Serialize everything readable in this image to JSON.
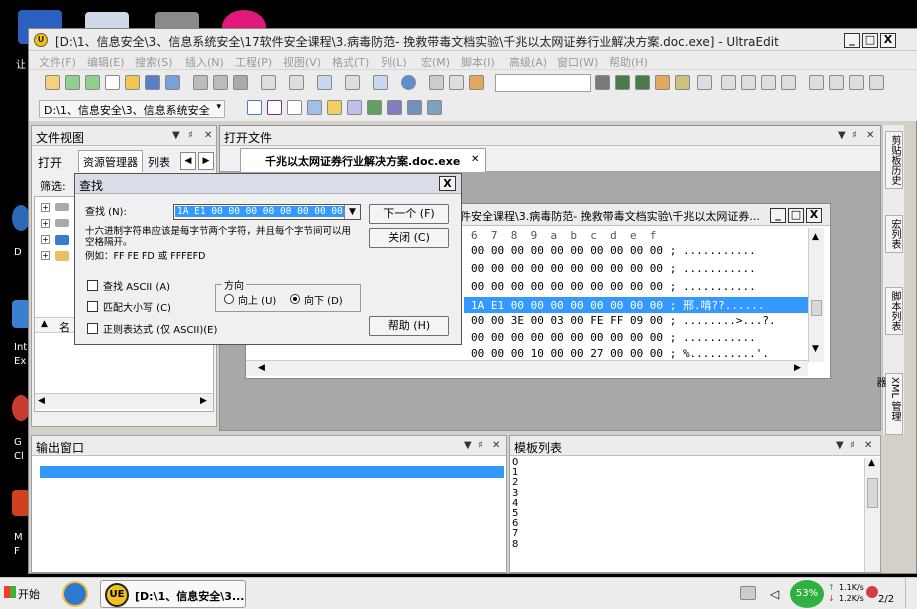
{
  "window": {
    "title": "[D:\\1、信息安全\\3、信息系统安全\\17软件安全课程\\3.病毒防范- 挽救带毒文档实验\\千兆以太网证券行业解决方案.doc.exe] - UltraEdit",
    "min": "_",
    "max": "□",
    "close": "X"
  },
  "menu": [
    "文件(F)",
    "编辑(E)",
    "搜索(S)",
    "插入(N)",
    "工程(P)",
    "视图(V)",
    "格式(T)",
    "列(L)",
    "宏(M)",
    "脚本(I)",
    "高级(A)",
    "窗口(W)",
    "帮助(H)"
  ],
  "path_dropdown": "D:\\1、信息安全\\3、信息系统安全",
  "file_view": {
    "title": "文件视图",
    "tabs": [
      "打开",
      "资源管理器",
      "列表"
    ],
    "filter_label": "筛选:",
    "sort_label": "名"
  },
  "open_files": {
    "title": "打开文件",
    "tab": "千兆以太网证券行业解决方案.doc.exe"
  },
  "hex_window": {
    "title": "件安全课程\\3.病毒防范- 挽救带毒文档实验\\千兆以太网证券...",
    "col_header": "6  7  8  9  a  b  c  d  e  f",
    "rows": [
      {
        "hex": "00 00 00 00 00 00 00 00 00 00",
        "sep": ";",
        "ascii": "..........."
      },
      {
        "hex": "00 00 00 00 00 00 00 00 00 00",
        "sep": ";",
        "ascii": "..........."
      },
      {
        "hex": "00 00 00 00 00 00 00 00 00 00",
        "sep": ";",
        "ascii": "..........."
      },
      {
        "hex": "1A E1 00 00 00 00 00 00 00 00",
        "sep": ";",
        "ascii": "邢.啃??......"
      },
      {
        "hex": "00 00 3E 00 03 00 FE FF 09 00",
        "sep": ";",
        "ascii": "........>...?."
      },
      {
        "hex": "00 00 00 00 00 00 00 00 00 00",
        "sep": ";",
        "ascii": "..........."
      },
      {
        "hex": "00 00 00 10 00 00 27 00 00 00",
        "sep": ";",
        "ascii": "%..........'."
      }
    ]
  },
  "find_dialog": {
    "title": "查找",
    "find_label": "查找 (N):",
    "find_value": "1A E1 00 00 00 00 00 00 00 00",
    "hint": "十六进制字符串应该是每字节两个字符，并且每个字节间可以用空格隔开。",
    "example": "例如：FF FE FD 或 FFFEFD",
    "find_next": "下一个 (F)",
    "close": "关闭 (C)",
    "help": "帮助 (H)",
    "opt_ascii": "查找 ASCII (A)",
    "opt_case": "匹配大小写 (C)",
    "opt_regex": "正则表达式 (仅 ASCII)(E)",
    "direction_label": "方向",
    "dir_up": "向上 (U)",
    "dir_down": "向下 (D)"
  },
  "output": {
    "title": "输出窗口"
  },
  "templates": {
    "title": "模板列表",
    "items": [
      "0",
      "1",
      "2",
      "3",
      "4",
      "5",
      "6",
      "7",
      "8"
    ]
  },
  "right_tabs": [
    "剪贴板历史",
    "宏列表",
    "脚本列表",
    "XML 管理器"
  ],
  "taskbar": {
    "start": "开始",
    "task_label": "[D:\\1、信息安全\\3...",
    "net_percent": "53%",
    "up_speed": "1.1K/s",
    "down_speed": "1.2K/s",
    "clock": "2/2"
  },
  "desktop_labels": [
    "让",
    "Int",
    "Ex",
    "G",
    "Cl",
    "M",
    "F",
    "D"
  ]
}
